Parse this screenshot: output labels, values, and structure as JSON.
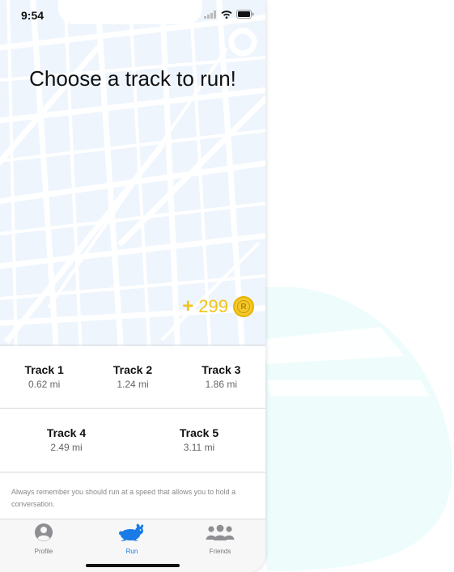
{
  "status_bar": {
    "time": "9:54"
  },
  "header": {
    "title": "Choose a track to run!"
  },
  "reward": {
    "prefix": "+",
    "amount": "299",
    "coin_letter": "R"
  },
  "tracks": [
    {
      "name": "Track 1",
      "distance": "0.62 mi"
    },
    {
      "name": "Track 2",
      "distance": "1.24 mi"
    },
    {
      "name": "Track 3",
      "distance": "1.86 mi"
    },
    {
      "name": "Track 4",
      "distance": "2.49 mi"
    },
    {
      "name": "Track 5",
      "distance": "3.11 mi"
    }
  ],
  "note": "Always remember you should run at a speed that allows you to hold a conversation.",
  "tabs": [
    {
      "label": "Profile",
      "icon": "person-icon",
      "active": false
    },
    {
      "label": "Run",
      "icon": "rabbit-icon",
      "active": true
    },
    {
      "label": "Friends",
      "icon": "friends-icon",
      "active": false
    }
  ],
  "colors": {
    "accent": "#1a7be6",
    "coin": "#f2c416",
    "map_bg": "#eef5fd"
  }
}
